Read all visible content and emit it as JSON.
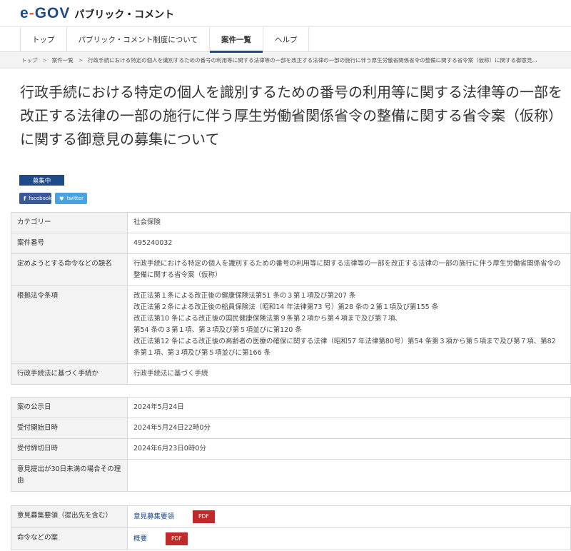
{
  "header": {
    "logo_mark_left": "e",
    "logo_mark_dash": "-",
    "logo_mark_right": "GOV",
    "logo_text": "パブリック・コメント"
  },
  "nav": {
    "items": [
      {
        "label": "トップ"
      },
      {
        "label": "パブリック・コメント制度について"
      },
      {
        "label": "案件一覧"
      },
      {
        "label": "ヘルプ"
      }
    ],
    "active": "案件一覧"
  },
  "breadcrumb": {
    "items": [
      "トップ",
      "案件一覧",
      "行政手続における特定の個人を識別するための番号の利用等に関する法律等の一部を改正する法律の一部の施行に伴う厚生労働省関係省令の整備に関する省令案（仮称）に関する御意見..."
    ],
    "separator": ">"
  },
  "page_title": "行政手続における特定の個人を識別するための番号の利用等に関する法律等の一部を改正する法律の一部の施行に伴う厚生労働省関係省令の整備に関する省令案（仮称）に関する御意見の募集について",
  "status_badge": "募集中",
  "share": {
    "facebook_icon": "f",
    "facebook_label": "facebook",
    "twitter_icon": "♥",
    "twitter_label": "twitter"
  },
  "details": {
    "category_label": "カテゴリー",
    "category_value": "社会保険",
    "case_no_label": "案件番号",
    "case_no_value": "495240032",
    "order_title_label": "定めようとする命令などの題名",
    "order_title_value": "行政手続における特定の個人を識別するための番号の利用等に関する法律等の一部を改正する法律の一部の施行に伴う厚生労働省関係省令の整備に関する省令案（仮称）",
    "basis_label": "根拠法令条項",
    "basis_lines": [
      "改正法第１条による改正後の健康保険法第51 条の３第１項及び第207 条",
      "改正法第２条による改正後の船員保険法（昭和14 年法律第73 号）第28 条の２第１項及び第155 条",
      "改正法第10 条による改正後の国民健康保険法第９条第２項から第４項まで及び第７項、",
      "第54 条の３第１項、第３項及び第５項並びに第120 条",
      "改正法第12 条による改正後の高齢者の医療の確保に関する法律（昭和57 年法律第80号）第54 条第３項から第５項まで及び第７項、第82 条第１項、第３項及び第５項並びに第166 条"
    ],
    "procedure_label": "行政手続法に基づく手続か",
    "procedure_value": "行政手続法に基づく手続"
  },
  "dates": {
    "announce_label": "案の公示日",
    "announce_value": "2024年5月24日",
    "start_label": "受付開始日時",
    "start_value": "2024年5月24日22時0分",
    "end_label": "受付締切日時",
    "end_value": "2024年6月23日0時0分",
    "reason_label": "意見提出が30日未満の場合その理由",
    "reason_value": ""
  },
  "documents": {
    "guideline_label": "意見募集要領（提出先を含む）",
    "guideline_link": "意見募集要領",
    "guideline_pdf": "PDF",
    "order_label": "命令などの案",
    "order_link": "概要",
    "order_pdf": "PDF"
  }
}
